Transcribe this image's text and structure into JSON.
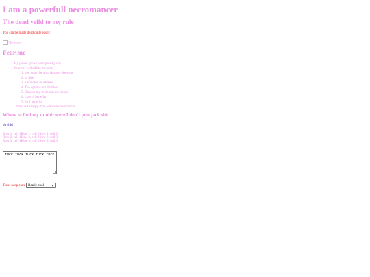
{
  "title": "I am a powerfull necromancer",
  "subtitle": "The dead yeild to my rule",
  "tagline": "You can be made dead quite easily",
  "image_alt": "Skeletons",
  "fear_heading": "Fear me",
  "list": {
    "items": [
      "My power grows each passing day",
      "Your vet will add to my army",
      "I make out sloppy style with a technomancer"
    ],
    "subitems": [
      "you could be a tirrakossus skeleton",
      "or like",
      "a skeleton musketeer",
      "The options are limitless",
      "Oh also my skeletons are union",
      "Lots of benefits",
      "Evil benefits"
    ]
  },
  "tumblr_heading": "Where to find my tumblr were I don't post jack shit",
  "link_text": "oh shid",
  "table": {
    "rows": [
      [
        "Row 1, cell 1",
        "Row 1, cell 2",
        "Row 1, cell 3"
      ],
      [
        "Row 2, cell 1",
        "Row 2, cell 2",
        "Row 2, cell 3"
      ],
      [
        "Row 3, cell 1",
        "Row 3, cell 2",
        "Row 3, cell 3"
      ]
    ]
  },
  "textarea_value": "fuck fuck fuck fuck fuck",
  "select_label": "Trans people are",
  "select_value": "Really cool",
  "colors": {
    "accent": "#ea8fe0",
    "warning": "#ee1c1c",
    "link": "#1a0dab"
  }
}
